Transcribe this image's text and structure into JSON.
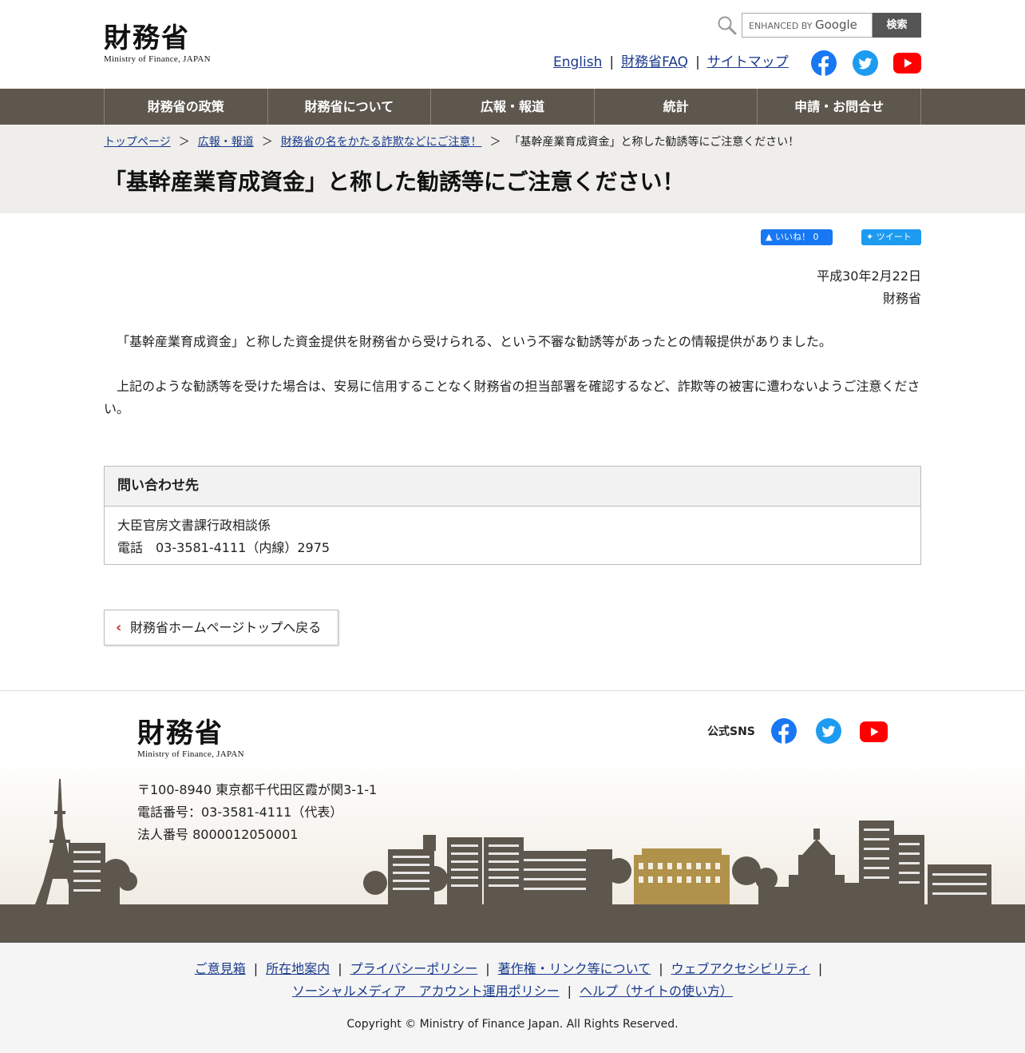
{
  "header": {
    "logo_kanji": "財務省",
    "logo_en": "Ministry of Finance, JAPAN",
    "search": {
      "placeholder_prefix": "ENHANCED BY",
      "placeholder_brand": "Google",
      "button_label": "検索"
    },
    "links": [
      "English",
      "財務省FAQ",
      "サイトマップ"
    ],
    "link_separator": "|",
    "sns": [
      "facebook-icon",
      "twitter-icon",
      "youtube-icon"
    ]
  },
  "nav": {
    "items": [
      "財務省の政策",
      "財務省について",
      "広報・報道",
      "統計",
      "申請・お問合せ"
    ]
  },
  "breadcrumb": {
    "items": [
      "トップページ",
      "広報・報道",
      "財務省の名をかたる詐欺などにご注意！"
    ],
    "current": "「基幹産業育成資金」と称した勧誘等にご注意ください！",
    "separator": "＞"
  },
  "page": {
    "title": "「基幹産業育成資金」と称した勧誘等にご注意ください！",
    "like_label": "いいね！ 0",
    "tweet_label": "ツイート",
    "date": "平成30年2月22日",
    "issuer": "財務省",
    "paragraph1": "「基幹産業育成資金」と称した資金提供を財務省から受けられる、という不審な勧誘等があったとの情報提供がありました。",
    "paragraph2": "上記のような勧誘等を受けた場合は、安易に信用することなく財務省の担当部署を確認するなど、詐欺等の被害に遭わないようご注意ください。"
  },
  "contact": {
    "heading": "問い合わせ先",
    "department": "大臣官房文書課行政相談係",
    "phone": "電話　03-3581-4111（内線）2975"
  },
  "back_button": {
    "label": "財務省ホームページトップへ戻る"
  },
  "footer": {
    "logo_kanji": "財務省",
    "logo_en": "Ministry of Finance, JAPAN",
    "sns_label": "公式SNS",
    "address": "〒100-8940 東京都千代田区霞が関3-1-1",
    "phone": "電話番号：03-3581-4111（代表）",
    "corporate_number": "法人番号 8000012050001",
    "links_row1": [
      "ご意見箱",
      "所在地案内",
      "プライバシーポリシー",
      "著作権・リンク等について",
      "ウェブアクセシビリティ"
    ],
    "links_row2": [
      "ソーシャルメディア　アカウント運用ポリシー",
      "ヘルプ（サイトの使い方）"
    ],
    "copyright": "Copyright © Ministry of Finance Japan. All Rights Reserved."
  },
  "colors": {
    "nav_bg": "#5e574e",
    "link": "#1a3a8c",
    "facebook": "#1877f2",
    "twitter": "#1d9bf0",
    "youtube": "#ff0000",
    "building_gold": "#b0924a"
  }
}
